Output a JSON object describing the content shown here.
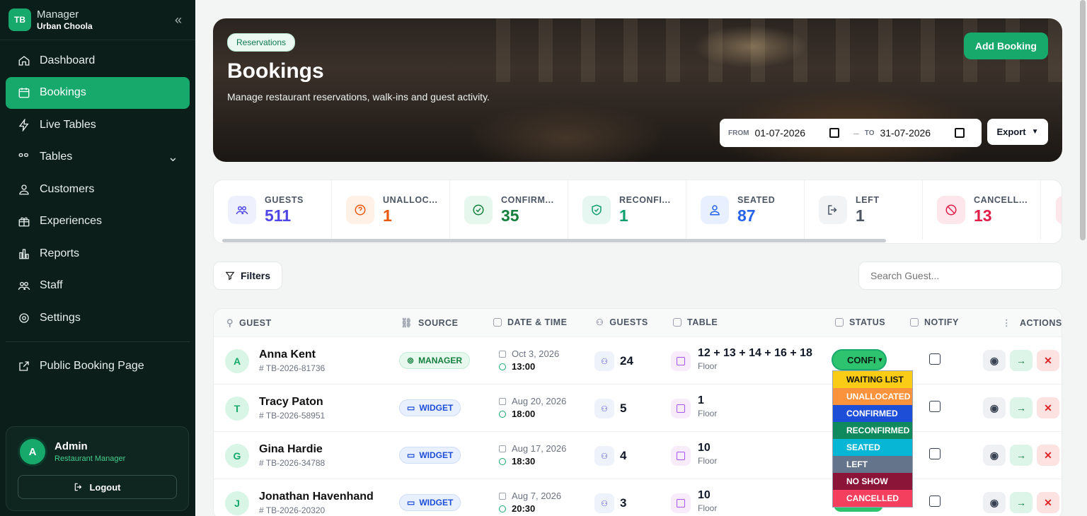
{
  "brand": {
    "logo": "TB",
    "title": "Manager",
    "subtitle": "Urban Choola",
    "collapse_icon": "«"
  },
  "nav": [
    {
      "label": "Dashboard",
      "icon": "home-icon"
    },
    {
      "label": "Bookings",
      "icon": "calendar-icon",
      "active": true
    },
    {
      "label": "Live Tables",
      "icon": "bolt-icon"
    },
    {
      "label": "Tables",
      "icon": "tables-icon",
      "chevron": "⌄"
    },
    {
      "label": "Customers",
      "icon": "user-icon"
    },
    {
      "label": "Experiences",
      "icon": "gift-icon"
    },
    {
      "label": "Reports",
      "icon": "chart-icon"
    },
    {
      "label": "Staff",
      "icon": "users-icon"
    },
    {
      "label": "Settings",
      "icon": "gear-icon"
    },
    {
      "label": "Public Booking Page",
      "icon": "external-link-icon"
    }
  ],
  "profile": {
    "initial": "A",
    "name": "Admin",
    "role": "Restaurant Manager",
    "logout": "Logout"
  },
  "hero": {
    "badge": "Reservations",
    "title": "Bookings",
    "subtitle": "Manage restaurant reservations, walk-ins and guest activity.",
    "add_button": "Add Booking",
    "from_label": "FROM",
    "from_value": "01-07-2026",
    "to_label": "TO",
    "to_value": "31-07-2026",
    "separator": "–",
    "export": "Export"
  },
  "stats": [
    {
      "label": "GUESTS",
      "value": "511",
      "color": "#4f46e5",
      "bg": "#eef0fd"
    },
    {
      "label": "UNALLOC...",
      "value": "1",
      "color": "#ea580c",
      "bg": "#fff1e6"
    },
    {
      "label": "CONFIRM...",
      "value": "35",
      "color": "#15803d",
      "bg": "#e6f7ee"
    },
    {
      "label": "RECONFI...",
      "value": "1",
      "color": "#0f9f6e",
      "bg": "#e6f7f1"
    },
    {
      "label": "SEATED",
      "value": "87",
      "color": "#2563eb",
      "bg": "#e8efff"
    },
    {
      "label": "LEFT",
      "value": "1",
      "color": "#4b5563",
      "bg": "#f1f3f5"
    },
    {
      "label": "CANCELL...",
      "value": "13",
      "color": "#e11d48",
      "bg": "#fde7ec"
    }
  ],
  "toolbar": {
    "filters": "Filters",
    "search_placeholder": "Search Guest..."
  },
  "columns": [
    "GUEST",
    "SOURCE",
    "DATE & TIME",
    "GUESTS",
    "TABLE",
    "STATUS",
    "NOTIFY",
    "ACTIONS"
  ],
  "rows": [
    {
      "initial": "A",
      "name": "Anna Kent",
      "ref": "# TB-2026-81736",
      "source": "MANAGER",
      "source_icon": "⊚",
      "date": "Oct 3, 2026",
      "time": "13:00",
      "guests": "24",
      "table": "12 + 13 + 14 + 16 + 18",
      "area": "Floor"
    },
    {
      "initial": "T",
      "name": "Tracy Paton",
      "ref": "# TB-2026-58951",
      "source": "WIDGET",
      "source_icon": "▭",
      "date": "Aug 20, 2026",
      "time": "18:00",
      "guests": "5",
      "table": "1",
      "area": "Floor"
    },
    {
      "initial": "G",
      "name": "Gina Hardie",
      "ref": "# TB-2026-34788",
      "source": "WIDGET",
      "source_icon": "▭",
      "date": "Aug 17, 2026",
      "time": "18:30",
      "guests": "4",
      "table": "10",
      "area": "Floor"
    },
    {
      "initial": "J",
      "name": "Jonathan Havenhand",
      "ref": "# TB-2026-20320",
      "source": "WIDGET",
      "source_icon": "▭",
      "date": "Aug 7, 2026",
      "time": "20:30",
      "guests": "3",
      "table": "10",
      "area": "Floor"
    }
  ],
  "status_select": {
    "value": "CONFI",
    "chevron": "⌄"
  },
  "status_options": [
    {
      "label": "WAITING LIST",
      "bg": "#facc15",
      "fg": "#111111"
    },
    {
      "label": "UNALLOCATED",
      "bg": "#fb923c",
      "fg": "#ffffff"
    },
    {
      "label": "CONFIRMED",
      "bg": "#1d4ed8",
      "fg": "#ffffff"
    },
    {
      "label": "RECONFIRMED",
      "bg": "#0f8a5f",
      "fg": "#ffffff"
    },
    {
      "label": "SEATED",
      "bg": "#06b6d4",
      "fg": "#ffffff"
    },
    {
      "label": "LEFT",
      "bg": "#64748b",
      "fg": "#ffffff"
    },
    {
      "label": "NO SHOW",
      "bg": "#8b1538",
      "fg": "#ffffff"
    },
    {
      "label": "CANCELLED",
      "bg": "#f43f5e",
      "fg": "#ffffff"
    }
  ],
  "actions": {
    "view": "◉",
    "go": "→",
    "delete": "✕"
  }
}
